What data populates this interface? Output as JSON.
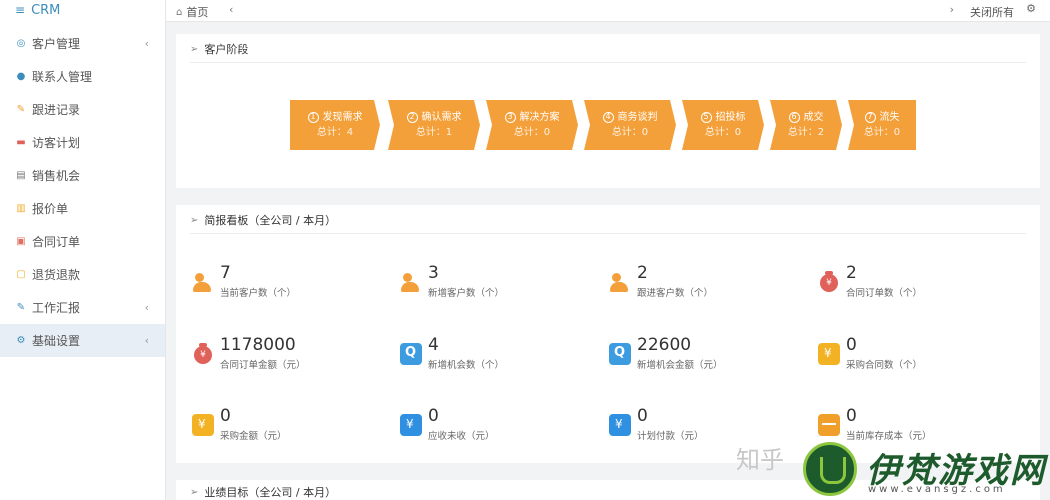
{
  "brand": {
    "menu_icon": "hamburger-icon",
    "name": "CRM"
  },
  "sidebar": {
    "items": [
      {
        "label": "客户管理",
        "icon": "customers-icon",
        "has_submenu": true,
        "active": false
      },
      {
        "label": "联系人管理",
        "icon": "contact-icon",
        "has_submenu": false,
        "active": false
      },
      {
        "label": "跟进记录",
        "icon": "edit-icon",
        "has_submenu": false,
        "active": false
      },
      {
        "label": "访客计划",
        "icon": "car-icon",
        "has_submenu": false,
        "active": false
      },
      {
        "label": "销售机会",
        "icon": "chart-icon",
        "has_submenu": false,
        "active": false
      },
      {
        "label": "报价单",
        "icon": "document-icon",
        "has_submenu": false,
        "active": false
      },
      {
        "label": "合同订单",
        "icon": "contract-icon",
        "has_submenu": false,
        "active": false
      },
      {
        "label": "退货退款",
        "icon": "return-icon",
        "has_submenu": false,
        "active": false
      },
      {
        "label": "工作汇报",
        "icon": "report-icon",
        "has_submenu": true,
        "active": false
      },
      {
        "label": "基础设置",
        "icon": "settings-icon",
        "has_submenu": true,
        "active": true
      }
    ]
  },
  "topbar": {
    "home_label": "首页",
    "close_all_label": "关闭所有"
  },
  "stage_panel": {
    "title": "客户阶段",
    "stages": [
      {
        "num": "1",
        "label": "发现需求",
        "count": "总计：4"
      },
      {
        "num": "2",
        "label": "确认需求",
        "count": "总计：1"
      },
      {
        "num": "3",
        "label": "解决方案",
        "count": "总计：0"
      },
      {
        "num": "4",
        "label": "商务谈判",
        "count": "总计：0"
      },
      {
        "num": "5",
        "label": "招投标",
        "count": "总计：0"
      },
      {
        "num": "6",
        "label": "成交",
        "count": "总计：2"
      },
      {
        "num": "7",
        "label": "流失",
        "count": "总计：0"
      }
    ],
    "color": "#f4a03a"
  },
  "report_panel": {
    "title": "简报看板（全公司 / 本月）",
    "stats": [
      {
        "value": "7",
        "label": "当前客户数（个）",
        "icon": "user-icon"
      },
      {
        "value": "3",
        "label": "新增客户数（个）",
        "icon": "user-icon"
      },
      {
        "value": "2",
        "label": "跟进客户数（个）",
        "icon": "user-icon"
      },
      {
        "value": "2",
        "label": "合同订单数（个）",
        "icon": "money-bag-icon"
      },
      {
        "value": "1178000",
        "label": "合同订单金额（元）",
        "icon": "money-bag-icon"
      },
      {
        "value": "4",
        "label": "新增机会数（个）",
        "icon": "search-icon"
      },
      {
        "value": "22600",
        "label": "新增机会金额（元）",
        "icon": "search-icon"
      },
      {
        "value": "0",
        "label": "采购合同数（个）",
        "icon": "gold-yen-icon"
      },
      {
        "value": "0",
        "label": "采购金额（元）",
        "icon": "gold-yen-icon"
      },
      {
        "value": "0",
        "label": "应收未收（元）",
        "icon": "wallet-icon"
      },
      {
        "value": "0",
        "label": "计划付款（元）",
        "icon": "wallet-icon"
      },
      {
        "value": "0",
        "label": "当前库存成本（元）",
        "icon": "box-icon"
      }
    ]
  },
  "target_panel": {
    "title": "业绩目标（全公司 / 本月）"
  },
  "watermarks": {
    "zhihu": "知乎",
    "site_name": "伊梵游戏网",
    "site_url": "www.evansgz.com"
  },
  "colors": {
    "accent": "#3c8dbc",
    "stage": "#f4a03a",
    "active_bg": "#e8eef6"
  }
}
